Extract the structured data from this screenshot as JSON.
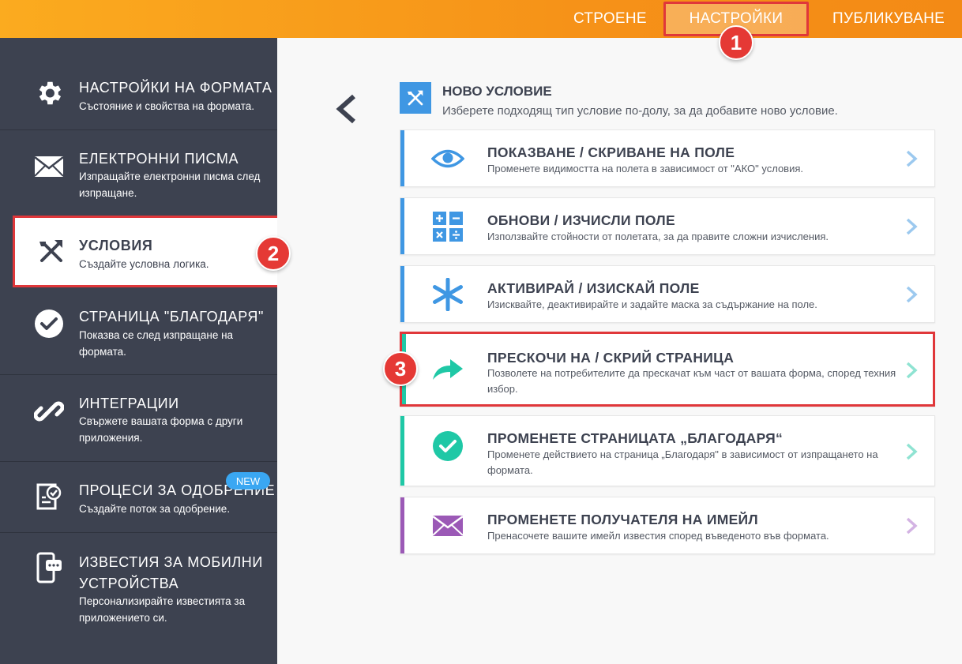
{
  "topnav": {
    "build": "СТРОЕНЕ",
    "settings": "НАСТРОЙКИ",
    "publish": "ПУБЛИКУВАНЕ"
  },
  "badges": {
    "one": "1",
    "two": "2",
    "three": "3"
  },
  "sidebar": {
    "items": [
      {
        "icon": "gear-icon",
        "title": "НАСТРОЙКИ НА ФОРМАТА",
        "desc": "Състояние и свойства на формата."
      },
      {
        "icon": "envelope-icon",
        "title": "ЕЛЕКТРОННИ ПИСМА",
        "desc": "Изпращайте електронни писма след изпращане."
      },
      {
        "icon": "conditions-icon",
        "title": "УСЛОВИЯ",
        "desc": "Създайте условна логика."
      },
      {
        "icon": "check-circle-icon",
        "title": "СТРАНИЦА \"БЛАГОДАРЯ\"",
        "desc": "Показва се след изпращане на формата."
      },
      {
        "icon": "link-icon",
        "title": "ИНТЕГРАЦИИ",
        "desc": "Свържете вашата форма с други приложения."
      },
      {
        "icon": "approval-icon",
        "title": "ПРОЦЕСИ ЗА ОДОБРЕНИЕ",
        "desc": "Създайте поток за одобрение.",
        "badge": "NEW"
      },
      {
        "icon": "mobile-icon",
        "title": "ИЗВЕСТИЯ ЗА МОБИЛНИ УСТРОЙСТВА",
        "desc": "Персонализирайте известията за приложението си."
      }
    ]
  },
  "main": {
    "title": "НОВО УСЛОВИЕ",
    "desc": "Изберете подходящ тип условие по-долу, за да добавите ново условие.",
    "cards": [
      {
        "icon": "eye-icon",
        "title": "ПОКАЗВАНЕ / СКРИВАНЕ НА ПОЛЕ",
        "desc": "Променете видимостта на полета в зависимост от \"АКО\" условия.",
        "color": "#3f97e3"
      },
      {
        "icon": "calculator-icon",
        "title": "ОБНОВИ / ИЗЧИСЛИ ПОЛЕ",
        "desc": "Използвайте стойности от полетата, за да правите сложни изчисления.",
        "color": "#3f97e3"
      },
      {
        "icon": "asterisk-icon",
        "title": "АКТИВИРАЙ / ИЗИСКАЙ ПОЛЕ",
        "desc": "Изисквайте, деактивирайте и задайте маска за съдържание на поле.",
        "color": "#3f97e3"
      },
      {
        "icon": "skip-arrow-icon",
        "title": "ПРЕСКОЧИ НА / СКРИЙ СТРАНИЦА",
        "desc": "Позволете на потребителите да прескачат към част от вашата форма, според техния избор.",
        "color": "#1fc8a6"
      },
      {
        "icon": "check-circle-icon",
        "title": "ПРОМЕНЕТЕ СТРАНИЦАТА „БЛАГОДАРЯ“",
        "desc": "Променете действието на страница „Благодаря\" в зависимост от изпращането на формата.",
        "color": "#1fc8a6"
      },
      {
        "icon": "envelope-icon",
        "title": "ПРОМЕНЕТЕ ПОЛУЧАТЕЛЯ НА ИМЕЙЛ",
        "desc": "Пренасочете вашите имейл известия според въведеното във формата.",
        "color": "#9b59b6"
      }
    ]
  },
  "colors": {
    "accent_orange": "#f69218",
    "sidebar": "#3d4250",
    "highlight_red": "#e0373a",
    "blue": "#3f97e3",
    "teal": "#1fc8a6",
    "purple": "#9b59b6"
  }
}
